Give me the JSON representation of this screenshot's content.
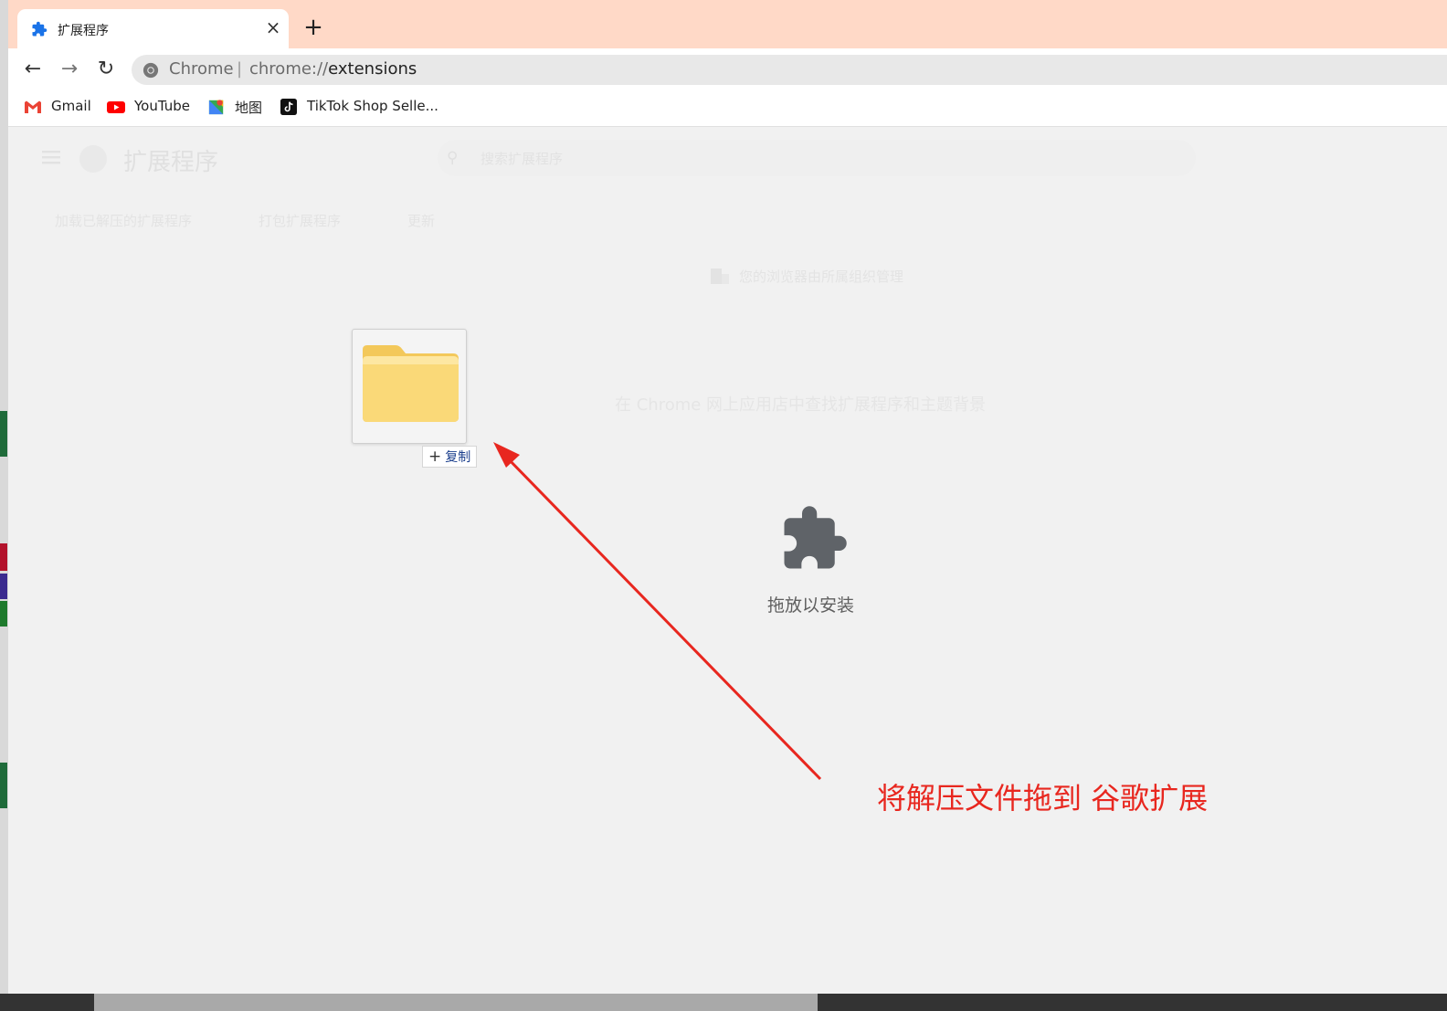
{
  "tab": {
    "title": "扩展程序",
    "close": "×"
  },
  "new_tab": "+",
  "toolbar": {
    "back": "←",
    "forward": "→",
    "reload": "↻"
  },
  "omnibox": {
    "chrome_label": "Chrome",
    "separator": "|",
    "url_prefix": "chrome://",
    "url_path": "extensions"
  },
  "bookmarks": [
    {
      "label": "Gmail",
      "icon": "gmail-icon"
    },
    {
      "label": "YouTube",
      "icon": "youtube-icon"
    },
    {
      "label": "地图",
      "icon": "maps-icon"
    },
    {
      "label": "TikTok Shop Selle...",
      "icon": "tiktok-icon"
    }
  ],
  "extensions_page": {
    "title": "扩展程序",
    "search_placeholder": "搜索扩展程序",
    "actions": [
      "加载已解压的扩展程序",
      "打包扩展程序",
      "更新"
    ],
    "managed_notice": "您的浏览器由所属组织管理",
    "store_link": "在 Chrome 网上应用店中查找扩展程序和主题背景"
  },
  "drag": {
    "copy_plus": "+",
    "copy_label": "复制"
  },
  "drop_zone": {
    "label": "拖放以安装"
  },
  "annotation": {
    "text": "将解压文件拖到 谷歌扩展",
    "color": "#e8271f"
  },
  "colors": {
    "tabstrip": "#ffd9c7",
    "content_bg": "#f1f1f1"
  }
}
